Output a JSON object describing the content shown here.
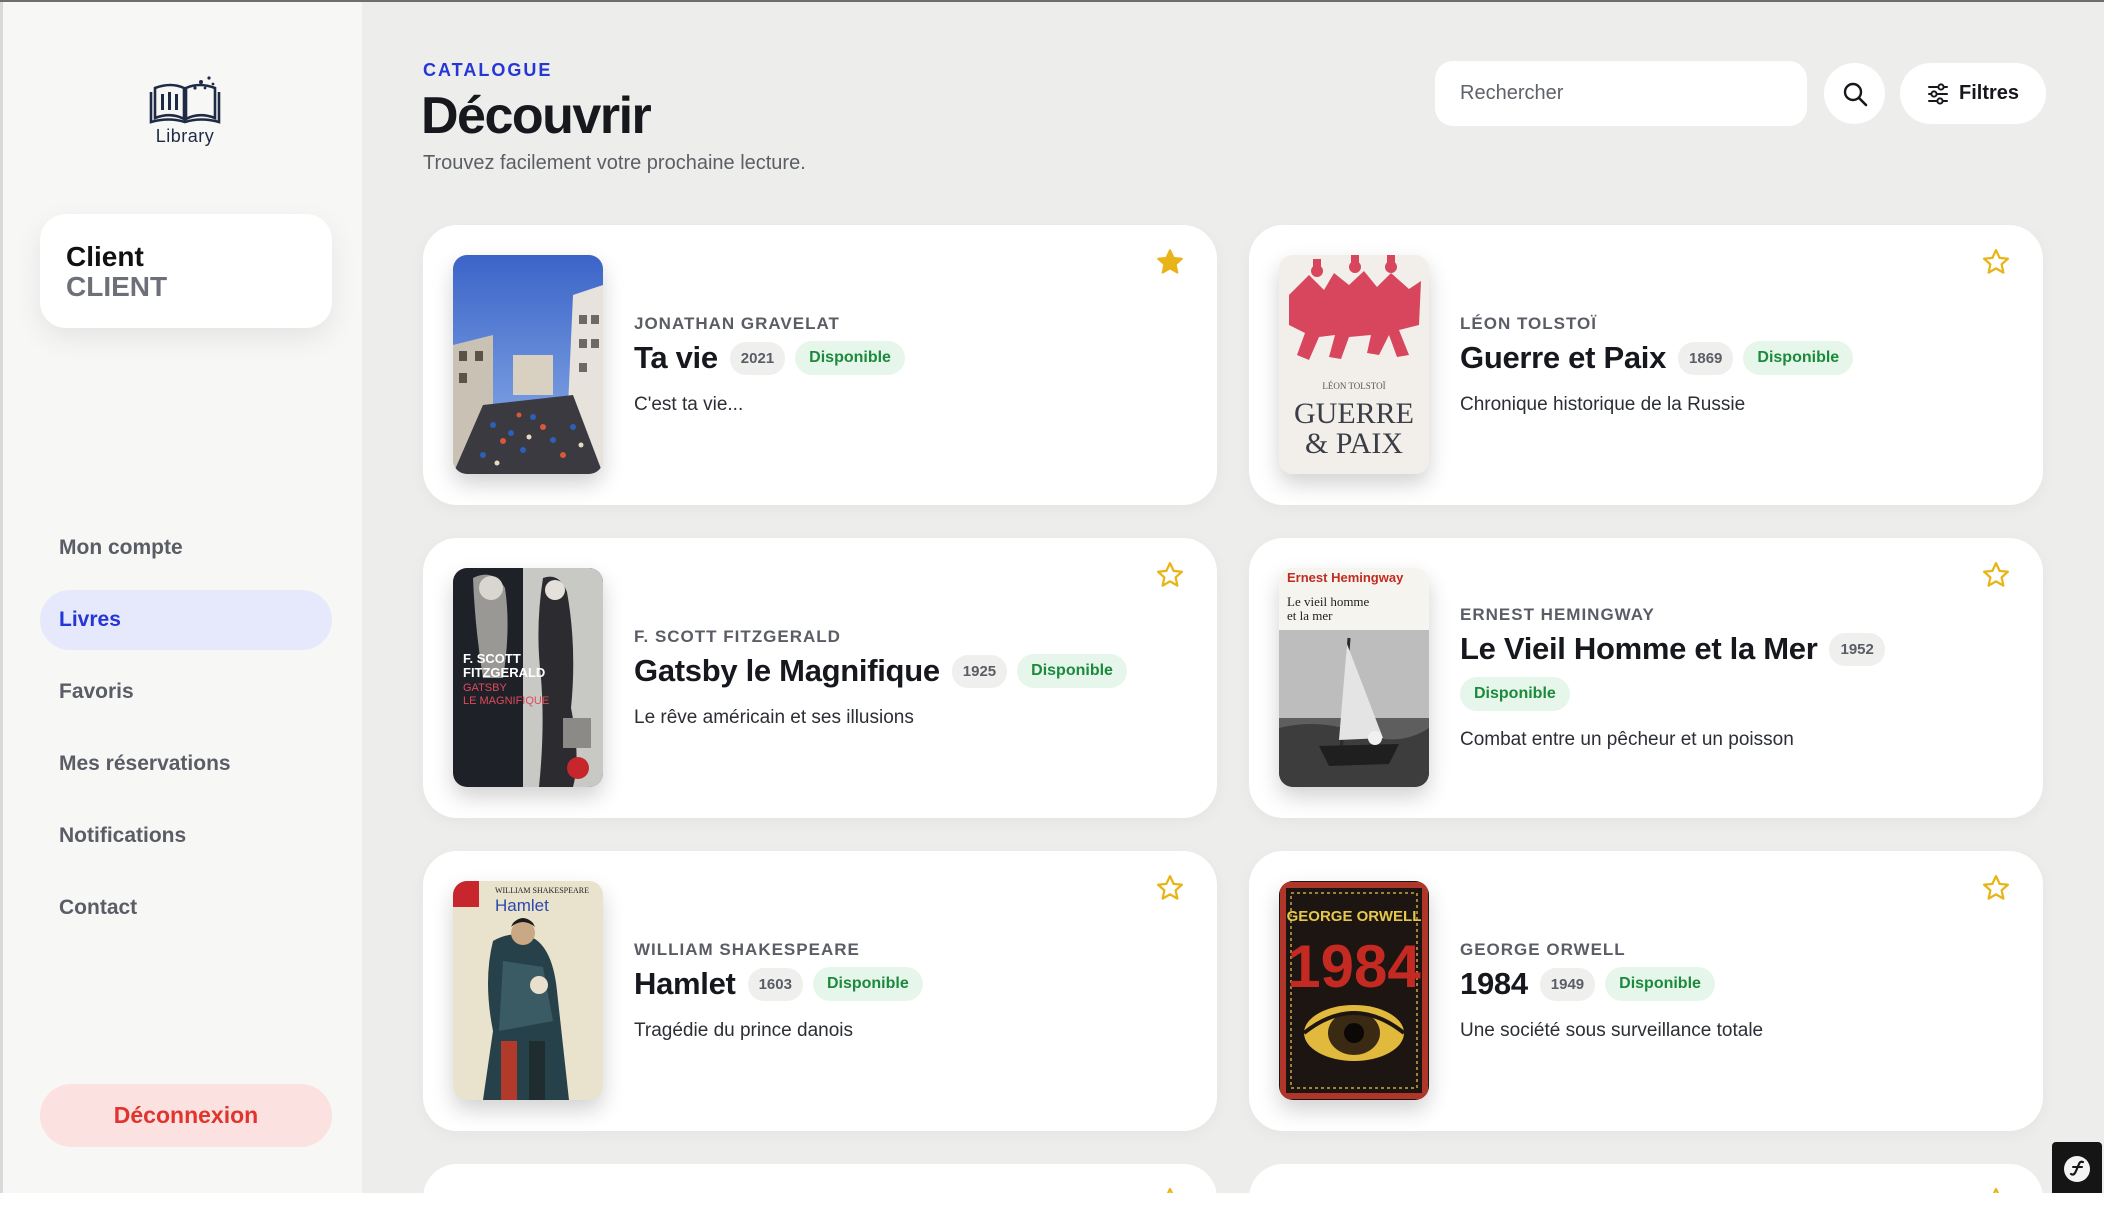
{
  "brand": {
    "logo_text": "Library"
  },
  "user": {
    "name": "Client",
    "role": "CLIENT"
  },
  "nav": {
    "items": [
      {
        "label": "Mon compte"
      },
      {
        "label": "Livres"
      },
      {
        "label": "Favoris"
      },
      {
        "label": "Mes réservations"
      },
      {
        "label": "Notifications"
      },
      {
        "label": "Contact"
      }
    ],
    "active": "Livres"
  },
  "logout_label": "Déconnexion",
  "header": {
    "eyebrow": "CATALOGUE",
    "title": "Découvrir",
    "subtitle": "Trouvez facilement votre prochaine lecture."
  },
  "search": {
    "placeholder": "Rechercher",
    "value": ""
  },
  "filters_label": "Filtres",
  "status_label": "Disponible",
  "books": [
    {
      "author": "JONATHAN GRAVELAT",
      "title": "Ta vie",
      "year": "2021",
      "status": "Disponible",
      "description": "C'est ta vie...",
      "favorite": true
    },
    {
      "author": "LÉON TOLSTOÏ",
      "title": "Guerre et Paix",
      "year": "1869",
      "status": "Disponible",
      "description": "Chronique historique de la Russie",
      "favorite": false
    },
    {
      "author": "F. SCOTT FITZGERALD",
      "title": "Gatsby le Magnifique",
      "year": "1925",
      "status": "Disponible",
      "description": "Le rêve américain et ses illusions",
      "favorite": false
    },
    {
      "author": "ERNEST HEMINGWAY",
      "title": "Le Vieil Homme et la Mer",
      "year": "1952",
      "status": "Disponible",
      "description": "Combat entre un pêcheur et un poisson",
      "favorite": false
    },
    {
      "author": "WILLIAM SHAKESPEARE",
      "title": "Hamlet",
      "year": "1603",
      "status": "Disponible",
      "description": "Tragédie du prince danois",
      "favorite": false
    },
    {
      "author": "GEORGE ORWELL",
      "title": "1984",
      "year": "1949",
      "status": "Disponible",
      "description": "Une société sous surveillance totale",
      "favorite": false
    }
  ],
  "covers": {
    "tolstoi": {
      "author": "LÉON TOLSTOÏ",
      "line1": "GUERRE",
      "line2": "& PAIX"
    },
    "gatsby": {
      "line1": "F. SCOTT",
      "line2": "FITZGERALD",
      "line3": "GATSBY",
      "line4": "LE MAGNIFIQUE"
    },
    "hemingway": {
      "author": "Ernest Hemingway",
      "line1": "Le vieil homme",
      "line2": "et la mer"
    },
    "hamlet": {
      "author": "WILLIAM SHAKESPEARE",
      "title": "Hamlet"
    },
    "orwell": {
      "author": "GEORGE ORWELL",
      "title": "1984"
    }
  },
  "icons": {
    "search": "search-icon",
    "filters": "sliders-icon",
    "favorite": "star-icon",
    "dev_toolbar": "symfony-icon"
  },
  "colors": {
    "accent": "#2536d6",
    "available_bg": "#e6f6ea",
    "available_text": "#1c8a3c",
    "logout_bg": "#fbe1e0",
    "logout_text": "#e0342f",
    "star": "#e8b418"
  }
}
